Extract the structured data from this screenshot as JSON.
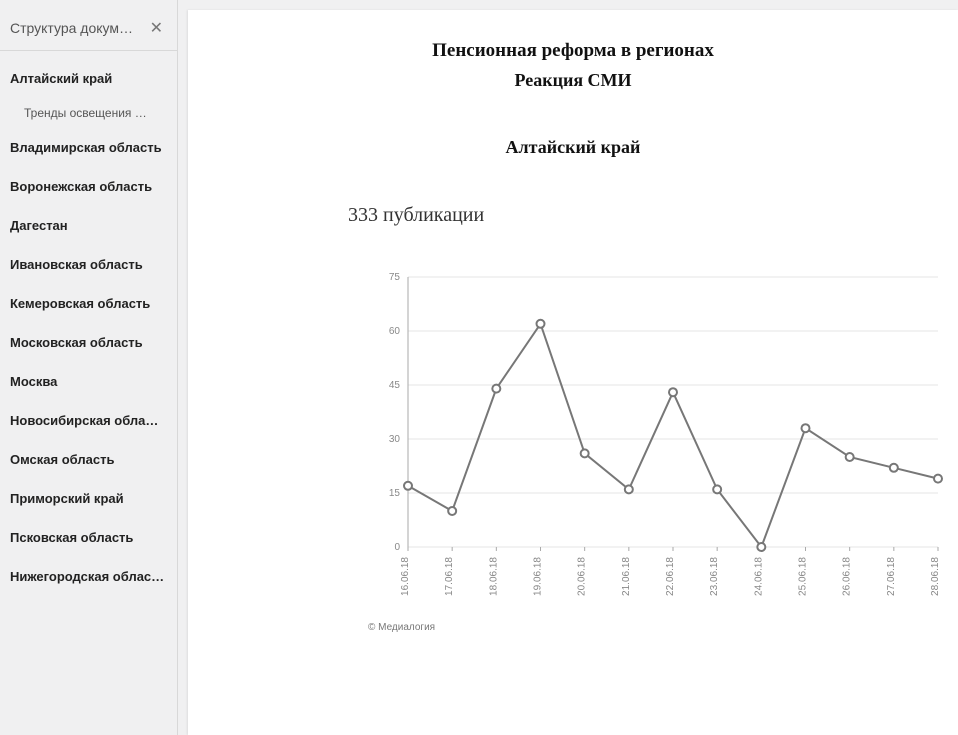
{
  "sidebar": {
    "title": "Структура докум…",
    "items": [
      {
        "label": "Алтайский край",
        "sub": [
          {
            "label": "Тренды освещения …"
          }
        ]
      },
      {
        "label": "Владимирская область"
      },
      {
        "label": "Воронежская область"
      },
      {
        "label": "Дагестан"
      },
      {
        "label": "Ивановская область"
      },
      {
        "label": "Кемеровская область"
      },
      {
        "label": "Московская область"
      },
      {
        "label": "Москва"
      },
      {
        "label": "Новосибирская обла…"
      },
      {
        "label": "Омская область"
      },
      {
        "label": "Приморский край"
      },
      {
        "label": "Псковская область"
      },
      {
        "label": "Нижегородская облас…"
      }
    ]
  },
  "document": {
    "title": "Пенсионная реформа в регионах",
    "subtitle": "Реакция СМИ",
    "section": "Алтайский край",
    "count_text": "333 публикации",
    "footer": "© Медиалогия"
  },
  "chart_data": {
    "type": "line",
    "title": "",
    "xlabel": "",
    "ylabel": "",
    "ylim": [
      0,
      75
    ],
    "yticks": [
      0,
      15,
      30,
      45,
      60,
      75
    ],
    "categories": [
      "16.06.18",
      "17.06.18",
      "18.06.18",
      "19.06.18",
      "20.06.18",
      "21.06.18",
      "22.06.18",
      "23.06.18",
      "24.06.18",
      "25.06.18",
      "26.06.18",
      "27.06.18",
      "28.06.18"
    ],
    "values": [
      17,
      10,
      44,
      62,
      26,
      16,
      43,
      16,
      0,
      33,
      25,
      22,
      19
    ]
  }
}
